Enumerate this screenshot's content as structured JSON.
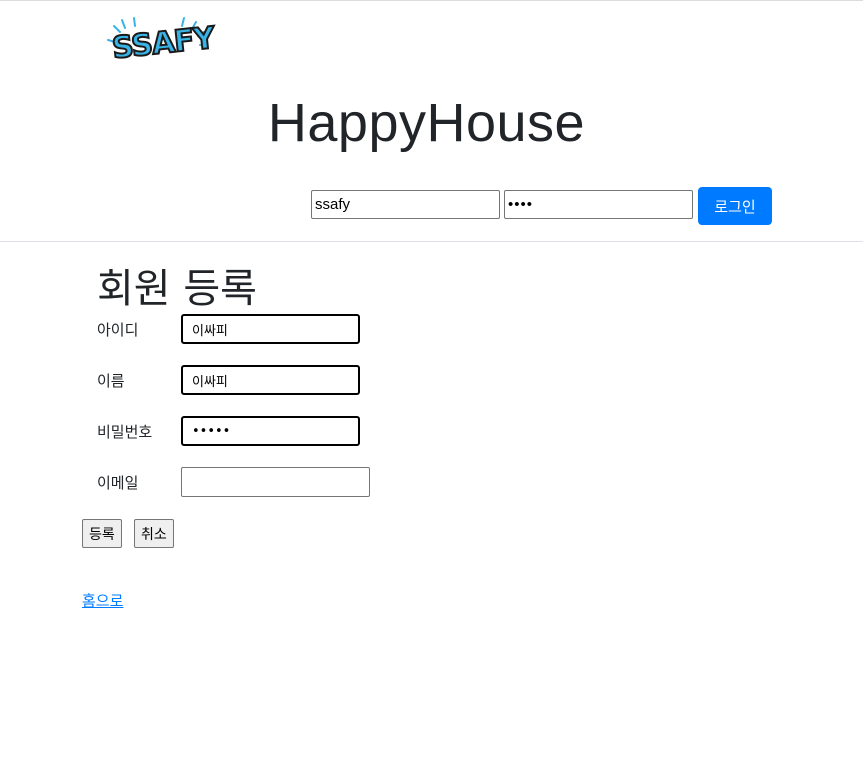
{
  "header": {
    "logo_text": "SSAFY",
    "site_title": "HappyHouse",
    "login": {
      "id_value": "ssafy",
      "password_value": "••••",
      "button_label": "로그인"
    }
  },
  "register": {
    "title": "회원 등록",
    "fields": [
      {
        "label": "아이디",
        "value": "이싸피"
      },
      {
        "label": "이름",
        "value": "이싸피"
      },
      {
        "label": "비밀번호",
        "value": "•••••"
      },
      {
        "label": "이메일",
        "value": ""
      }
    ],
    "submit_label": "등록",
    "cancel_label": "취소",
    "home_link": "홈으로"
  },
  "colors": {
    "accent": "#007bff",
    "logo_blue": "#38b3e6"
  }
}
